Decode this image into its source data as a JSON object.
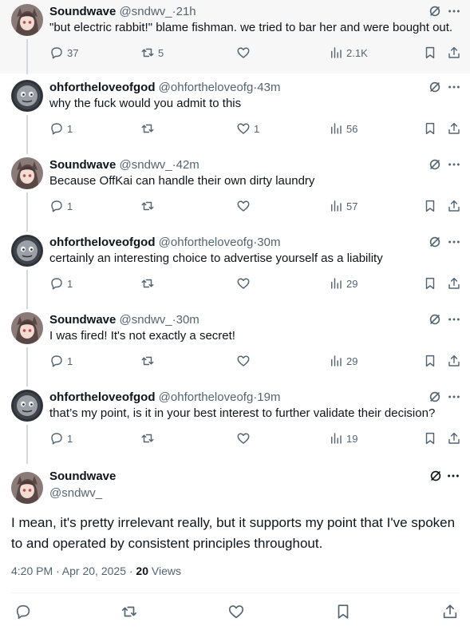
{
  "thread": [
    {
      "author": "Soundwave",
      "handle": "@sndwv_",
      "dot": "·",
      "time": "21h",
      "text": "\"but electric rabbit!\" blame fishman. we tried to bar her and were bought out.",
      "replies": "37",
      "retweets": "5",
      "likes": "",
      "views": "2.1K",
      "avatar": "anime"
    },
    {
      "author": "ohfortheloveofgod",
      "handle": "@ohfortheloveofg",
      "dot": "·",
      "time": "43m",
      "text": "why the fuck would you admit to this",
      "replies": "1",
      "retweets": "",
      "likes": "1",
      "views": "56",
      "avatar": "engine"
    },
    {
      "author": "Soundwave",
      "handle": "@sndwv_",
      "dot": "·",
      "time": "42m",
      "text": "Because OffKai can handle their own dirty laundry",
      "replies": "1",
      "retweets": "",
      "likes": "",
      "views": "57",
      "avatar": "anime"
    },
    {
      "author": "ohfortheloveofgod",
      "handle": "@ohfortheloveofg",
      "dot": "·",
      "time": "30m",
      "text": "certainly an interesting choice to advertise yourself as a liability",
      "replies": "1",
      "retweets": "",
      "likes": "",
      "views": "29",
      "avatar": "engine"
    },
    {
      "author": "Soundwave",
      "handle": "@sndwv_",
      "dot": "·",
      "time": "30m",
      "text": "I was fired! It's not exactly a secret!",
      "replies": "1",
      "retweets": "",
      "likes": "",
      "views": "29",
      "avatar": "anime"
    },
    {
      "author": "ohfortheloveofgod",
      "handle": "@ohfortheloveofg",
      "dot": "·",
      "time": "19m",
      "text": "that’s my point, is it in your best interest to further validate their decision?",
      "replies": "1",
      "retweets": "",
      "likes": "",
      "views": "19",
      "avatar": "engine"
    }
  ],
  "main_tweet": {
    "author": "Soundwave",
    "handle": "@sndwv_",
    "text": "I mean, it's pretty irrelevant really, but it supports my point that I've spoken to and operated by consistent principles throughout.",
    "timestamp": "4:20 PM · Apr 20, 2025 · ",
    "views_count": "20",
    "views_label": " Views"
  },
  "colors": {
    "text": "#0f1419",
    "secondary": "#536471",
    "thread_line": "#cfd9de",
    "highlight_bg": "#f7f7f7"
  },
  "icons": [
    "reply-icon",
    "retweet-icon",
    "like-icon",
    "views-icon",
    "bookmark-icon",
    "share-icon",
    "grok-icon",
    "more-icon"
  ]
}
